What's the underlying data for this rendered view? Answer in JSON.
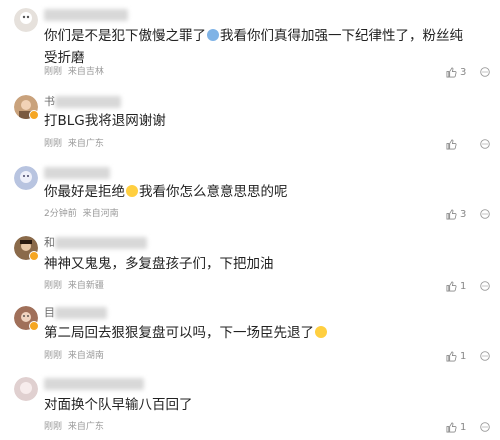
{
  "comments": [
    {
      "name_prefix": "",
      "text": "你们是不是犯下傲慢之罪了",
      "text2": "我看你们真得加强一下纪律性了，粉丝纯受折磨",
      "time": "刚刚",
      "location": "来自吉林",
      "likes": "3",
      "avatar_color": "#e6e1dc",
      "verified": false
    },
    {
      "name_prefix": "书",
      "text": "打BLG我将退网谢谢",
      "time": "刚刚",
      "location": "来自广东",
      "likes": "",
      "avatar_color": "#c9a27c",
      "verified": true
    },
    {
      "name_prefix": "",
      "text": "你最好是拒绝",
      "text2": "我看你怎么意意思思的呢",
      "time": "2分钟前",
      "location": "来自河南",
      "likes": "3",
      "avatar_color": "#b8c4e0",
      "verified": false
    },
    {
      "name_prefix": "和",
      "text": "神神又鬼鬼，多复盘孩子们，下把加油",
      "time": "刚刚",
      "location": "来自新疆",
      "likes": "1",
      "avatar_color": "#8a6a4a",
      "verified": true
    },
    {
      "name_prefix": "目",
      "text": "第二局回去狠狠复盘可以吗，下一场臣先退了",
      "time": "刚刚",
      "location": "来自湖南",
      "likes": "1",
      "avatar_color": "#a0705a",
      "verified": true
    },
    {
      "name_prefix": "",
      "text": "对面换个队早输八百回了",
      "time": "刚刚",
      "location": "来自广东",
      "likes": "1",
      "avatar_color": "#e0d0d0",
      "verified": false
    }
  ]
}
